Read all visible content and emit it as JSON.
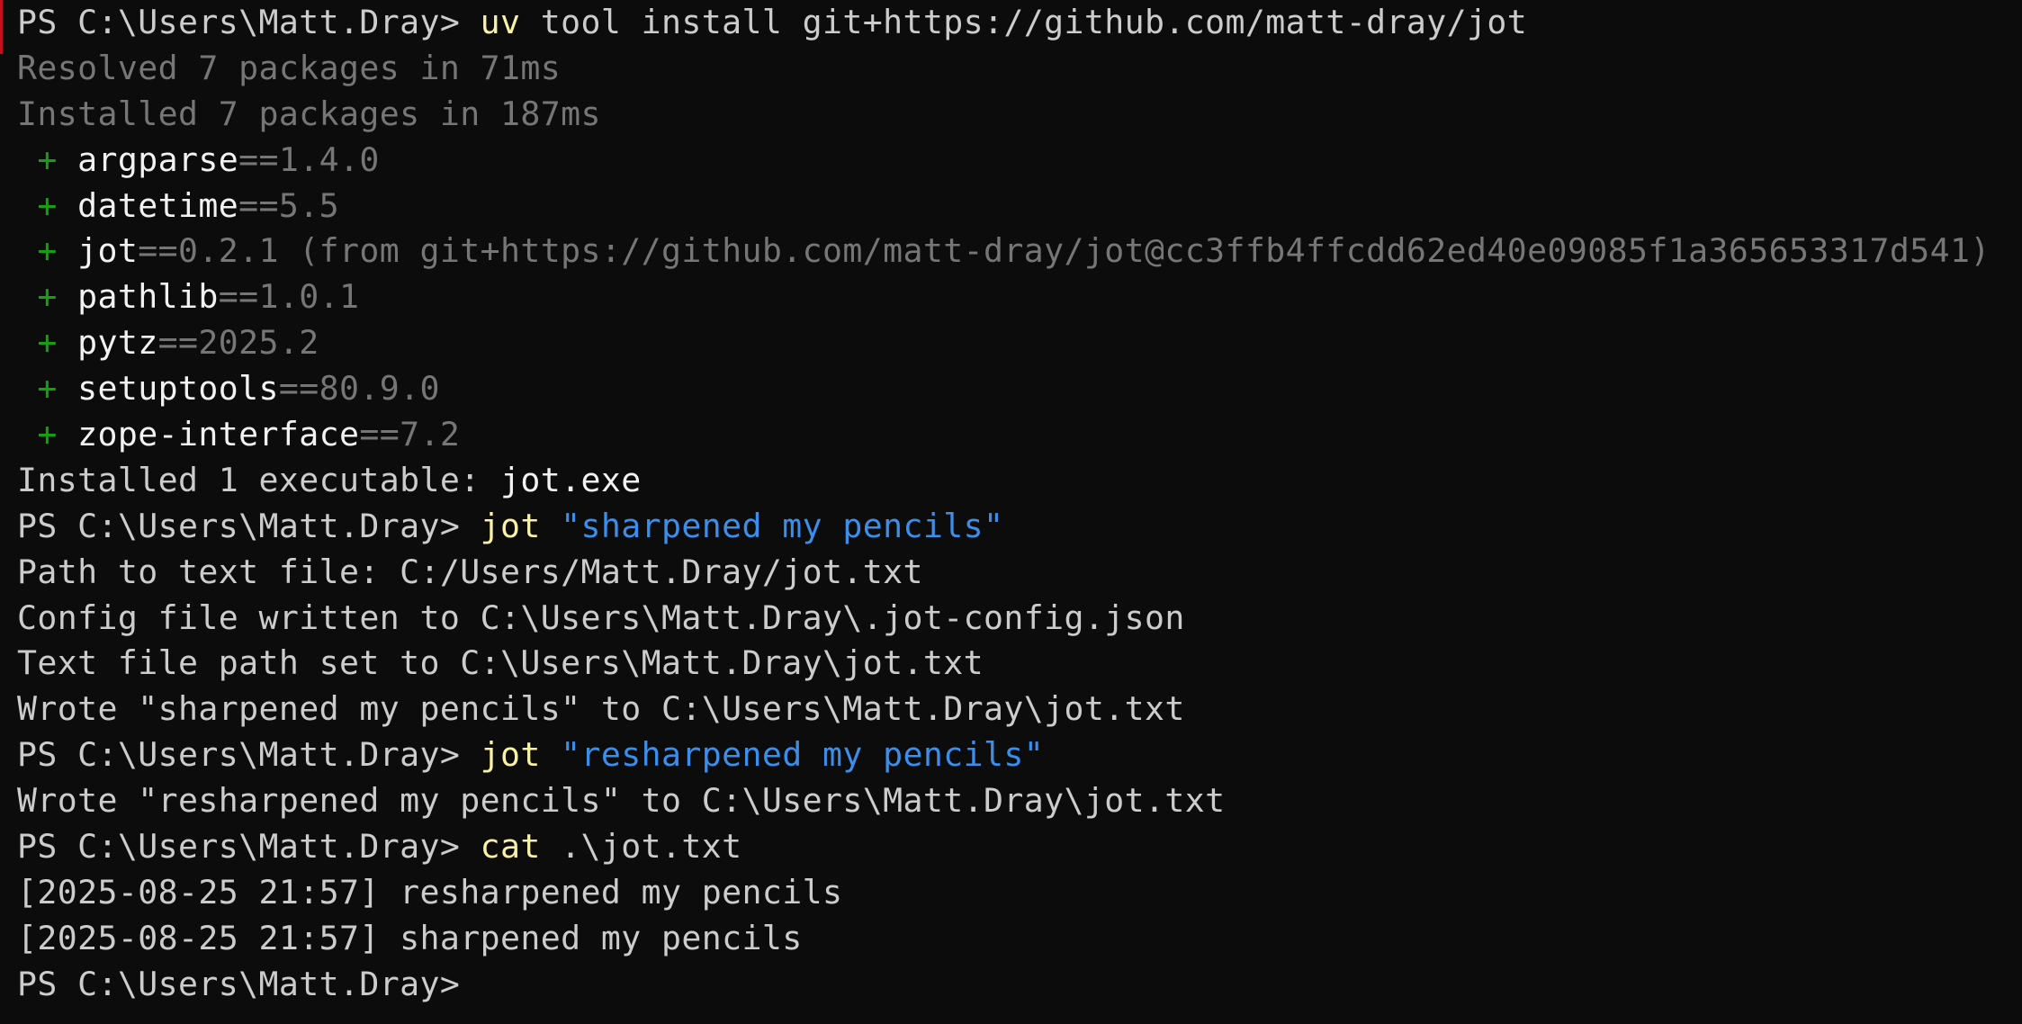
{
  "prompt": "PS C:\\Users\\Matt.Dray> ",
  "lines": {
    "l1": {
      "cmd": "uv",
      "rest": " tool install git+https://github.com/matt-dray/jot"
    },
    "l2": "Resolved 7 packages in 71ms",
    "l3": "Installed 7 packages in 187ms",
    "packages": [
      {
        "plus": " + ",
        "name": "argparse",
        "ver": "==1.4.0"
      },
      {
        "plus": " + ",
        "name": "datetime",
        "ver": "==5.5"
      },
      {
        "plus": " + ",
        "name": "jot",
        "ver": "==0.2.1 (from git+https://github.com/matt-dray/jot@cc3ffb4ffcdd62ed40e09085f1a365653317d541)"
      },
      {
        "plus": " + ",
        "name": "pathlib",
        "ver": "==1.0.1"
      },
      {
        "plus": " + ",
        "name": "pytz",
        "ver": "==2025.2"
      },
      {
        "plus": " + ",
        "name": "setuptools",
        "ver": "==80.9.0"
      },
      {
        "plus": " + ",
        "name": "zope-interface",
        "ver": "==7.2"
      }
    ],
    "exe_label": "Installed 1 executable: ",
    "exe_name": "jot.exe",
    "l12": {
      "cmd": "jot",
      "arg": " \"sharpened my pencils\""
    },
    "l13": "Path to text file: C:/Users/Matt.Dray/jot.txt",
    "l14": "Config file written to C:\\Users\\Matt.Dray\\.jot-config.json",
    "l15": "Text file path set to C:\\Users\\Matt.Dray\\jot.txt",
    "l16": "Wrote \"sharpened my pencils\" to C:\\Users\\Matt.Dray\\jot.txt",
    "l17": {
      "cmd": "jot",
      "arg": " \"resharpened my pencils\""
    },
    "l18": "Wrote \"resharpened my pencils\" to C:\\Users\\Matt.Dray\\jot.txt",
    "l19": {
      "cmd": "cat",
      "rest": " .\\jot.txt"
    },
    "l20": "[2025-08-25 21:57] resharpened my pencils",
    "l21": "[2025-08-25 21:57] sharpened my pencils"
  },
  "colors": {
    "background": "#0c0c0c",
    "foreground": "#cccccc",
    "dim": "#767676",
    "plus": "#13a10e",
    "command": "#f9f1a5",
    "string": "#3b8eea"
  }
}
